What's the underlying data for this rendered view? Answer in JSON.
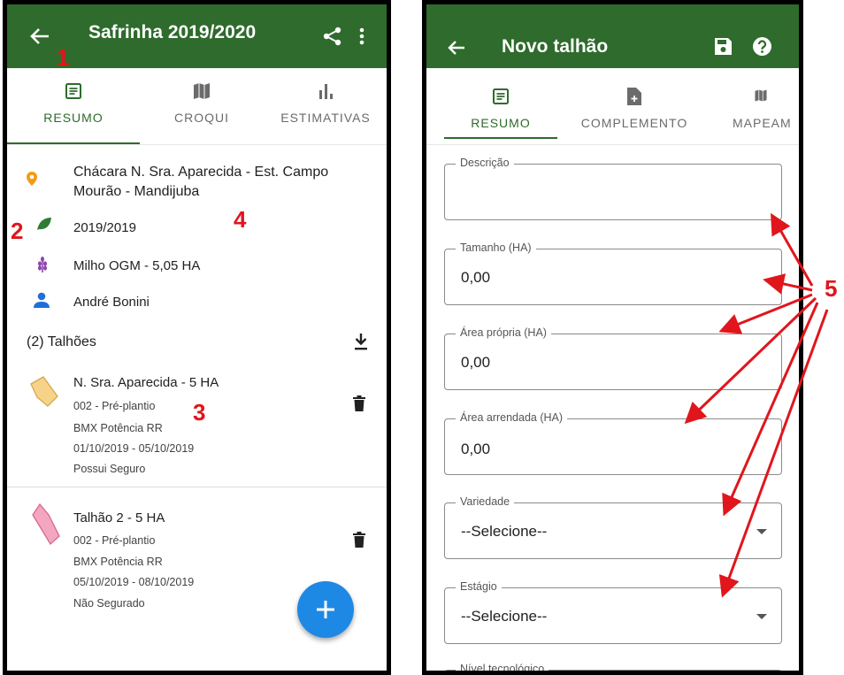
{
  "left": {
    "appbar": {
      "title": "Safrinha 2019/2020"
    },
    "tabs": [
      {
        "label": "RESUMO",
        "icon": "article-icon",
        "active": true
      },
      {
        "label": "CROQUI",
        "icon": "map-icon",
        "active": false
      },
      {
        "label": "ESTIMATIVAS",
        "icon": "bar-chart-icon",
        "active": false
      }
    ],
    "summary": {
      "location": "Chácara N. Sra. Aparecida - Est. Campo Mourão - Mandijuba",
      "season": "2019/2019",
      "crop": "Milho OGM - 5,05 HA",
      "owner": "André Bonini"
    },
    "plots_header": "(2) Talhões",
    "plots": [
      {
        "title": "N. Sra. Aparecida - 5 HA",
        "stage": "002 - Pré-plantio",
        "variety": "BMX Potência RR",
        "dates": "01/10/2019 - 05/10/2019",
        "insurance": "Possui Seguro",
        "color": "#f7d38a"
      },
      {
        "title": "Talhão 2 - 5 HA",
        "stage": "002 - Pré-plantio",
        "variety": "BMX Potência RR",
        "dates": "05/10/2019 - 08/10/2019",
        "insurance": "Não Segurado",
        "color": "#f4a6c0"
      }
    ]
  },
  "right": {
    "appbar": {
      "title": "Novo talhão"
    },
    "tabs": [
      {
        "label": "RESUMO",
        "icon": "article-icon",
        "active": true
      },
      {
        "label": "COMPLEMENTO",
        "icon": "note-add-icon",
        "active": false
      },
      {
        "label": "MAPEAM",
        "icon": "map-icon",
        "active": false
      }
    ],
    "fields": [
      {
        "label": "Descrição",
        "value": ""
      },
      {
        "label": "Tamanho (HA)",
        "value": "0,00"
      },
      {
        "label": "Área própria (HA)",
        "value": "0,00"
      },
      {
        "label": "Área arrendada (HA)",
        "value": "0,00"
      },
      {
        "label": "Variedade",
        "value": "--Selecione--"
      },
      {
        "label": "Estágio",
        "value": "--Selecione--"
      },
      {
        "label": "Nível tecnológico",
        "value": ""
      }
    ]
  },
  "annotations": [
    "1",
    "2",
    "3",
    "4",
    "5"
  ],
  "colors": {
    "appbar": "#2e6b2c",
    "accent": "#2e6b2c",
    "fab": "#1e88e5",
    "annotation": "#e0161c"
  }
}
